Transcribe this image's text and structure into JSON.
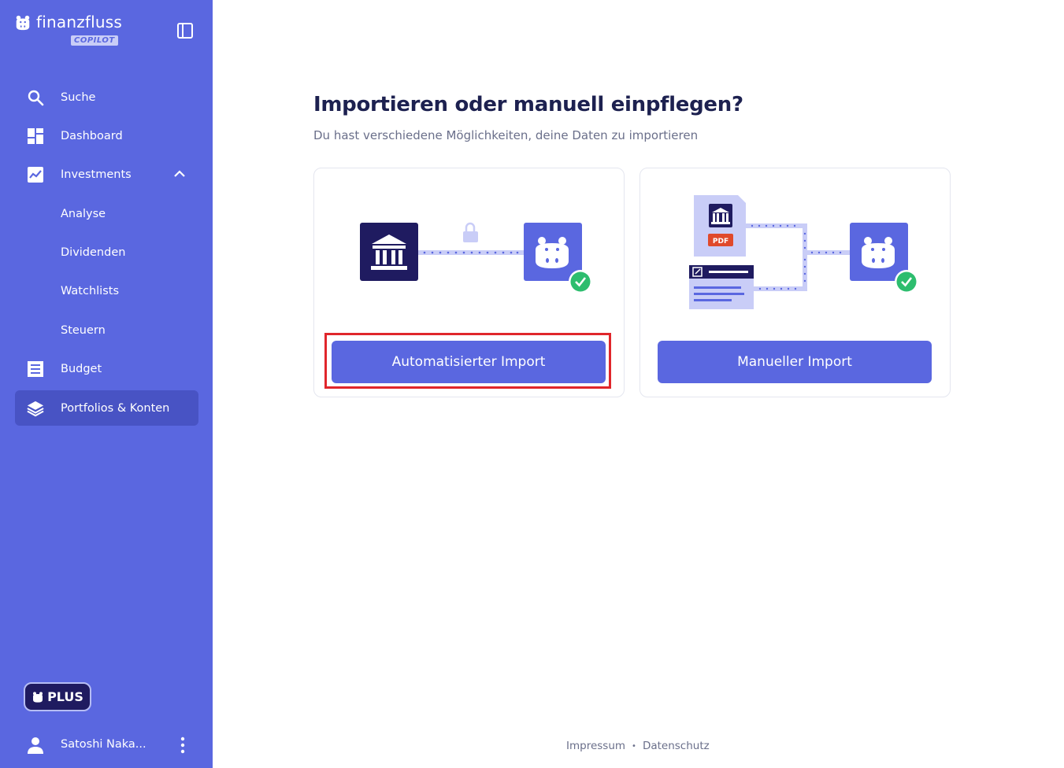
{
  "brand": {
    "name": "finanzfluss",
    "badge": "COPILOT"
  },
  "sidebar": {
    "items": [
      {
        "label": "Suche",
        "icon": "search-icon"
      },
      {
        "label": "Dashboard",
        "icon": "dashboard-icon"
      },
      {
        "label": "Investments",
        "icon": "chart-line-icon",
        "expanded": true
      },
      {
        "label": "Analyse"
      },
      {
        "label": "Dividenden"
      },
      {
        "label": "Watchlists"
      },
      {
        "label": "Steuern"
      },
      {
        "label": "Budget",
        "icon": "receipt-icon"
      },
      {
        "label": "Portfolios & Konten",
        "icon": "layers-icon",
        "active": true
      }
    ],
    "plus_label": "PLUS",
    "user_name": "Satoshi Naka..."
  },
  "main": {
    "title": "Importieren oder manuell einpflegen?",
    "subtitle": "Du hast verschiedene Möglichkeiten, deine Daten zu importieren",
    "cards": [
      {
        "button": "Automatisierter Import"
      },
      {
        "button": "Manueller Import",
        "pdf_label": "PDF"
      }
    ]
  },
  "footer": {
    "impressum": "Impressum",
    "separator": "•",
    "datenschutz": "Datenschutz"
  },
  "colors": {
    "sidebar": "#5a67e0",
    "sidebar_active": "#4853c4",
    "accent": "#5a67e0",
    "dark": "#1f1b60",
    "success": "#2dbd6e",
    "highlight": "#e0262b"
  }
}
